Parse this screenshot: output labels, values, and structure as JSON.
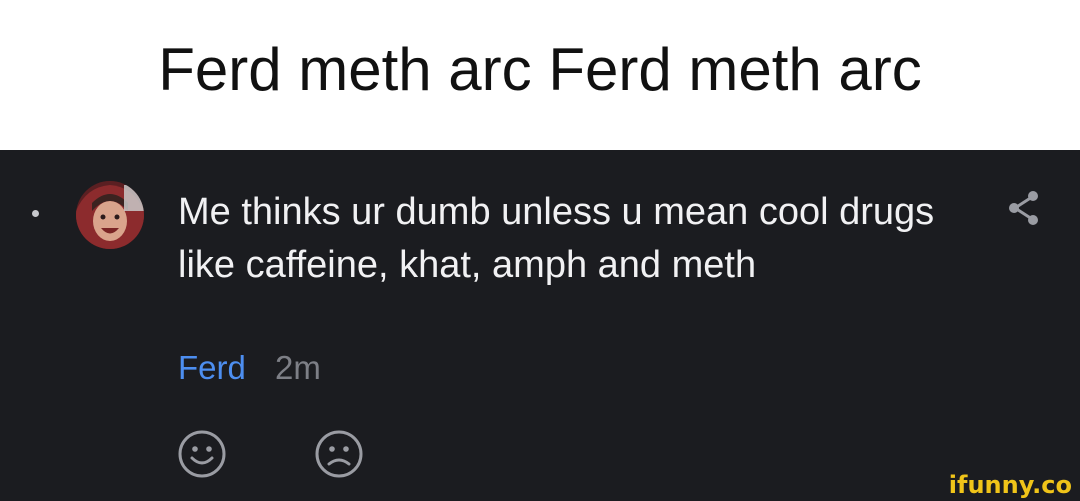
{
  "caption": {
    "text": "Ferd meth arc Ferd meth arc"
  },
  "comment": {
    "text": "Me thinks ur dumb unless u mean cool drugs like caffeine, khat, amph and meth",
    "username": "Ferd",
    "time": "2m",
    "avatar_icon": "user-avatar"
  },
  "actions": {
    "share_icon": "share-icon",
    "reactions": [
      {
        "icon": "smiley-face-icon"
      },
      {
        "icon": "sad-face-icon"
      }
    ]
  },
  "watermark": {
    "text": "ifunny.co"
  },
  "colors": {
    "panel_bg": "#1b1c20",
    "comment_text": "#f1f1f3",
    "username": "#4d8ef0",
    "timestamp": "#7d7f86",
    "icon": "#9a9ca3",
    "watermark": "#f0c419"
  }
}
